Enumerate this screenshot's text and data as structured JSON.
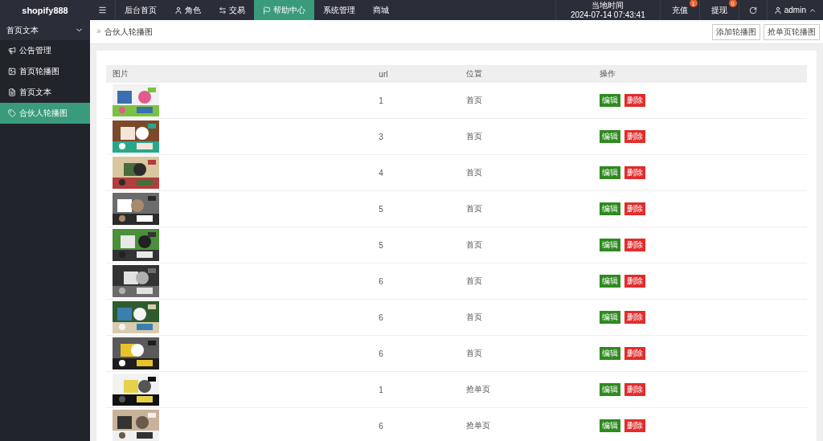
{
  "brand": "shopify888",
  "nav": [
    {
      "label": "后台首页",
      "selected": false
    },
    {
      "label": "角色",
      "selected": false
    },
    {
      "label": "交易",
      "selected": false
    },
    {
      "label": "帮助中心",
      "selected": true
    },
    {
      "label": "系统管理",
      "selected": false
    },
    {
      "label": "商城",
      "selected": false
    }
  ],
  "clock": {
    "label": "当地时间",
    "time": "2024-07-14 07:43:41"
  },
  "actions": [
    {
      "label": "充值",
      "badge": "1"
    },
    {
      "label": "提现",
      "badge": "0"
    }
  ],
  "user": {
    "name": "admin"
  },
  "sidebar": {
    "group": {
      "label": "首页文本",
      "expanded": true
    },
    "items": [
      {
        "label": "公告管理",
        "selected": false
      },
      {
        "label": "首页轮播图",
        "selected": false
      },
      {
        "label": "首页文本",
        "selected": false
      },
      {
        "label": "合伙人轮播图",
        "selected": true
      }
    ]
  },
  "breadcrumb": {
    "separator": "»",
    "label": "合伙人轮播图"
  },
  "toolbar_buttons": [
    "添加轮播图",
    "抢单页轮播图"
  ],
  "table": {
    "columns": [
      "图片",
      "url",
      "位置",
      "操作"
    ],
    "rows": [
      {
        "url": "1",
        "position": "首页",
        "actions": [
          {
            "label": "编辑",
            "kind": "edit"
          },
          {
            "label": "删除",
            "kind": "delete"
          }
        ]
      },
      {
        "url": "3",
        "position": "首页",
        "actions": [
          {
            "label": "编辑",
            "kind": "edit"
          },
          {
            "label": "删除",
            "kind": "delete"
          }
        ]
      },
      {
        "url": "4",
        "position": "首页",
        "actions": [
          {
            "label": "编辑",
            "kind": "edit"
          },
          {
            "label": "删除",
            "kind": "delete"
          }
        ]
      },
      {
        "url": "5",
        "position": "首页",
        "actions": [
          {
            "label": "编辑",
            "kind": "edit"
          },
          {
            "label": "删除",
            "kind": "delete"
          }
        ]
      },
      {
        "url": "5",
        "position": "首页",
        "actions": [
          {
            "label": "编辑",
            "kind": "edit"
          },
          {
            "label": "删除",
            "kind": "delete"
          }
        ]
      },
      {
        "url": "6",
        "position": "首页",
        "actions": [
          {
            "label": "编辑",
            "kind": "edit"
          },
          {
            "label": "删除",
            "kind": "delete"
          }
        ]
      },
      {
        "url": "6",
        "position": "首页",
        "actions": [
          {
            "label": "编辑",
            "kind": "edit"
          },
          {
            "label": "删除",
            "kind": "delete"
          }
        ]
      },
      {
        "url": "6",
        "position": "首页",
        "actions": [
          {
            "label": "编辑",
            "kind": "edit"
          },
          {
            "label": "删除",
            "kind": "delete"
          }
        ]
      },
      {
        "url": "1",
        "position": "抢单页",
        "actions": [
          {
            "label": "编辑",
            "kind": "edit"
          },
          {
            "label": "删除",
            "kind": "delete"
          }
        ]
      },
      {
        "url": "6",
        "position": "抢单页",
        "actions": [
          {
            "label": "编辑",
            "kind": "edit"
          },
          {
            "label": "删除",
            "kind": "delete"
          }
        ]
      }
    ]
  }
}
